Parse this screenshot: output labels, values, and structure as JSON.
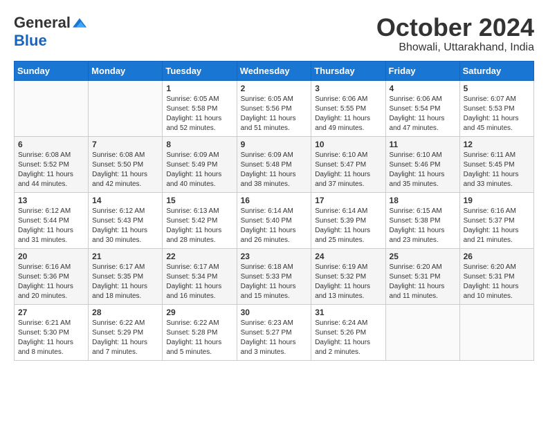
{
  "header": {
    "logo_general": "General",
    "logo_blue": "Blue",
    "month_title": "October 2024",
    "location": "Bhowali, Uttarakhand, India"
  },
  "days_of_week": [
    "Sunday",
    "Monday",
    "Tuesday",
    "Wednesday",
    "Thursday",
    "Friday",
    "Saturday"
  ],
  "weeks": [
    [
      {
        "day": "",
        "sunrise": "",
        "sunset": "",
        "daylight": ""
      },
      {
        "day": "",
        "sunrise": "",
        "sunset": "",
        "daylight": ""
      },
      {
        "day": "1",
        "sunrise": "Sunrise: 6:05 AM",
        "sunset": "Sunset: 5:58 PM",
        "daylight": "Daylight: 11 hours and 52 minutes."
      },
      {
        "day": "2",
        "sunrise": "Sunrise: 6:05 AM",
        "sunset": "Sunset: 5:56 PM",
        "daylight": "Daylight: 11 hours and 51 minutes."
      },
      {
        "day": "3",
        "sunrise": "Sunrise: 6:06 AM",
        "sunset": "Sunset: 5:55 PM",
        "daylight": "Daylight: 11 hours and 49 minutes."
      },
      {
        "day": "4",
        "sunrise": "Sunrise: 6:06 AM",
        "sunset": "Sunset: 5:54 PM",
        "daylight": "Daylight: 11 hours and 47 minutes."
      },
      {
        "day": "5",
        "sunrise": "Sunrise: 6:07 AM",
        "sunset": "Sunset: 5:53 PM",
        "daylight": "Daylight: 11 hours and 45 minutes."
      }
    ],
    [
      {
        "day": "6",
        "sunrise": "Sunrise: 6:08 AM",
        "sunset": "Sunset: 5:52 PM",
        "daylight": "Daylight: 11 hours and 44 minutes."
      },
      {
        "day": "7",
        "sunrise": "Sunrise: 6:08 AM",
        "sunset": "Sunset: 5:50 PM",
        "daylight": "Daylight: 11 hours and 42 minutes."
      },
      {
        "day": "8",
        "sunrise": "Sunrise: 6:09 AM",
        "sunset": "Sunset: 5:49 PM",
        "daylight": "Daylight: 11 hours and 40 minutes."
      },
      {
        "day": "9",
        "sunrise": "Sunrise: 6:09 AM",
        "sunset": "Sunset: 5:48 PM",
        "daylight": "Daylight: 11 hours and 38 minutes."
      },
      {
        "day": "10",
        "sunrise": "Sunrise: 6:10 AM",
        "sunset": "Sunset: 5:47 PM",
        "daylight": "Daylight: 11 hours and 37 minutes."
      },
      {
        "day": "11",
        "sunrise": "Sunrise: 6:10 AM",
        "sunset": "Sunset: 5:46 PM",
        "daylight": "Daylight: 11 hours and 35 minutes."
      },
      {
        "day": "12",
        "sunrise": "Sunrise: 6:11 AM",
        "sunset": "Sunset: 5:45 PM",
        "daylight": "Daylight: 11 hours and 33 minutes."
      }
    ],
    [
      {
        "day": "13",
        "sunrise": "Sunrise: 6:12 AM",
        "sunset": "Sunset: 5:44 PM",
        "daylight": "Daylight: 11 hours and 31 minutes."
      },
      {
        "day": "14",
        "sunrise": "Sunrise: 6:12 AM",
        "sunset": "Sunset: 5:43 PM",
        "daylight": "Daylight: 11 hours and 30 minutes."
      },
      {
        "day": "15",
        "sunrise": "Sunrise: 6:13 AM",
        "sunset": "Sunset: 5:42 PM",
        "daylight": "Daylight: 11 hours and 28 minutes."
      },
      {
        "day": "16",
        "sunrise": "Sunrise: 6:14 AM",
        "sunset": "Sunset: 5:40 PM",
        "daylight": "Daylight: 11 hours and 26 minutes."
      },
      {
        "day": "17",
        "sunrise": "Sunrise: 6:14 AM",
        "sunset": "Sunset: 5:39 PM",
        "daylight": "Daylight: 11 hours and 25 minutes."
      },
      {
        "day": "18",
        "sunrise": "Sunrise: 6:15 AM",
        "sunset": "Sunset: 5:38 PM",
        "daylight": "Daylight: 11 hours and 23 minutes."
      },
      {
        "day": "19",
        "sunrise": "Sunrise: 6:16 AM",
        "sunset": "Sunset: 5:37 PM",
        "daylight": "Daylight: 11 hours and 21 minutes."
      }
    ],
    [
      {
        "day": "20",
        "sunrise": "Sunrise: 6:16 AM",
        "sunset": "Sunset: 5:36 PM",
        "daylight": "Daylight: 11 hours and 20 minutes."
      },
      {
        "day": "21",
        "sunrise": "Sunrise: 6:17 AM",
        "sunset": "Sunset: 5:35 PM",
        "daylight": "Daylight: 11 hours and 18 minutes."
      },
      {
        "day": "22",
        "sunrise": "Sunrise: 6:17 AM",
        "sunset": "Sunset: 5:34 PM",
        "daylight": "Daylight: 11 hours and 16 minutes."
      },
      {
        "day": "23",
        "sunrise": "Sunrise: 6:18 AM",
        "sunset": "Sunset: 5:33 PM",
        "daylight": "Daylight: 11 hours and 15 minutes."
      },
      {
        "day": "24",
        "sunrise": "Sunrise: 6:19 AM",
        "sunset": "Sunset: 5:32 PM",
        "daylight": "Daylight: 11 hours and 13 minutes."
      },
      {
        "day": "25",
        "sunrise": "Sunrise: 6:20 AM",
        "sunset": "Sunset: 5:31 PM",
        "daylight": "Daylight: 11 hours and 11 minutes."
      },
      {
        "day": "26",
        "sunrise": "Sunrise: 6:20 AM",
        "sunset": "Sunset: 5:31 PM",
        "daylight": "Daylight: 11 hours and 10 minutes."
      }
    ],
    [
      {
        "day": "27",
        "sunrise": "Sunrise: 6:21 AM",
        "sunset": "Sunset: 5:30 PM",
        "daylight": "Daylight: 11 hours and 8 minutes."
      },
      {
        "day": "28",
        "sunrise": "Sunrise: 6:22 AM",
        "sunset": "Sunset: 5:29 PM",
        "daylight": "Daylight: 11 hours and 7 minutes."
      },
      {
        "day": "29",
        "sunrise": "Sunrise: 6:22 AM",
        "sunset": "Sunset: 5:28 PM",
        "daylight": "Daylight: 11 hours and 5 minutes."
      },
      {
        "day": "30",
        "sunrise": "Sunrise: 6:23 AM",
        "sunset": "Sunset: 5:27 PM",
        "daylight": "Daylight: 11 hours and 3 minutes."
      },
      {
        "day": "31",
        "sunrise": "Sunrise: 6:24 AM",
        "sunset": "Sunset: 5:26 PM",
        "daylight": "Daylight: 11 hours and 2 minutes."
      },
      {
        "day": "",
        "sunrise": "",
        "sunset": "",
        "daylight": ""
      },
      {
        "day": "",
        "sunrise": "",
        "sunset": "",
        "daylight": ""
      }
    ]
  ]
}
